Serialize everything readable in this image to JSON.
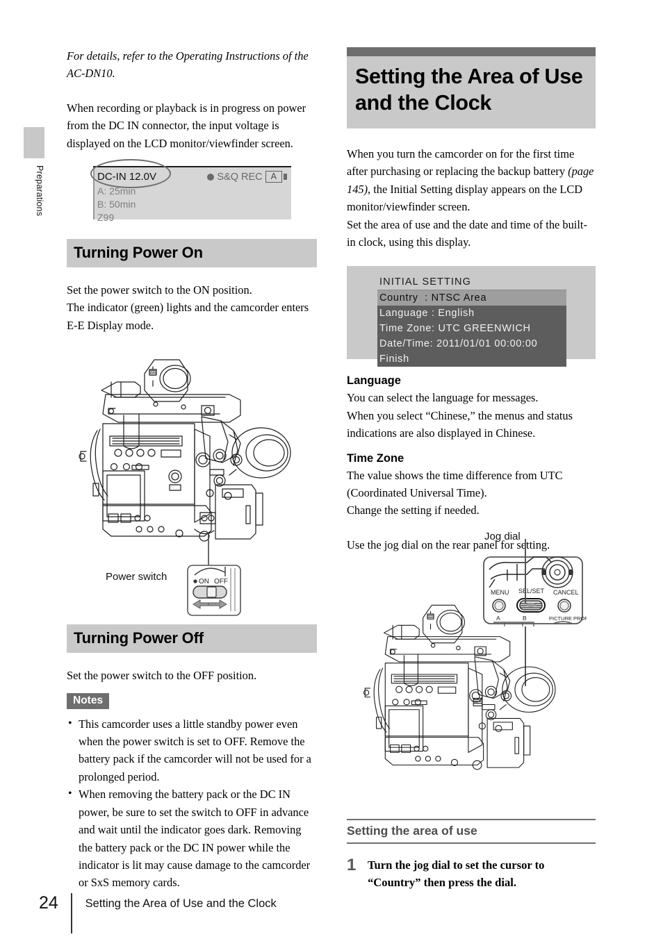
{
  "page": {
    "number": "24",
    "footer_title": "Setting the Area of Use and the Clock",
    "side_tab": "Preparations"
  },
  "left_column": {
    "intro_italic": "For details, refer to the Operating Instructions of the AC-DN10.",
    "paragraph_dcin": "When recording or playback is in progress on power from the DC IN connector, the input voltage is displayed on the LCD monitor/viewfinder screen.",
    "lcd_figure": {
      "dc_in": "DC-IN 12.0V",
      "slot_a": "A: 25min",
      "slot_b": "B: 50min",
      "clip": "Z99",
      "rec_mode": "S&Q REC",
      "slot_badge": "A"
    },
    "section_power_on": {
      "heading": "Turning Power On",
      "body": "Set the power switch to the ON position.\nThe indicator (green) lights and the camcorder enters E-E Display mode."
    },
    "switch_figure": {
      "caption": "Power switch",
      "on_label": "ON",
      "off_label": "OFF"
    },
    "section_power_off": {
      "heading": "Turning Power Off",
      "body": "Set the power switch to the OFF position.",
      "notes_badge": "Notes",
      "notes": [
        "This camcorder uses a little standby power even when the power switch is set to OFF. Remove the battery pack if the camcorder will not be used for a prolonged period.",
        "When removing the battery pack or the DC IN power, be sure to set the switch to OFF in advance and wait until the indicator goes dark. Removing the battery pack or the DC IN power while the indicator is lit may cause damage to the camcorder or SxS memory cards."
      ]
    }
  },
  "right_column": {
    "chapter_title": "Setting the Area of Use and the Clock",
    "intro_part1": "When you turn the camcorder on for the first time after purchasing or replacing the backup battery ",
    "intro_pagelink": "(page 145)",
    "intro_part2": ", the Initial Setting display appears on the LCD monitor/viewfinder screen.\nSet the area of use and the date and time of the built-in clock, using this display.",
    "menu_figure": {
      "title": "INITIAL SETTING",
      "rows": [
        {
          "label": "Country  : NTSC Area",
          "selected": true
        },
        {
          "label": "Language : English",
          "selected": false
        },
        {
          "label": "Time Zone: UTC GREENWICH",
          "selected": false
        },
        {
          "label": "Date/Time: 2011/01/01 00:00:00",
          "selected": false
        },
        {
          "label": "Finish",
          "selected": false
        }
      ]
    },
    "language_head": "Language",
    "language_body": "You can select the language for messages.\nWhen you select “Chinese,” the menus and status indications are also displayed in Chinese.",
    "timezone_head": "Time Zone",
    "timezone_body": "The value shows the time difference from UTC (Coordinated Universal Time).\nChange the setting if needed.",
    "jogdial_note": "Use the jog dial on the rear panel for setting.",
    "jog_figure": {
      "caption": "Jog dial",
      "menu": "MENU",
      "selset": "SEL/SET",
      "cancel": "CANCEL",
      "btn_a": "A",
      "btn_b": "B",
      "picture_prof": "PICTURE PROF"
    },
    "sub_head": "Setting the area of use",
    "step_1_num": "1",
    "step_1_text": "Turn the jog dial to set the cursor to “Country” then press the dial."
  }
}
